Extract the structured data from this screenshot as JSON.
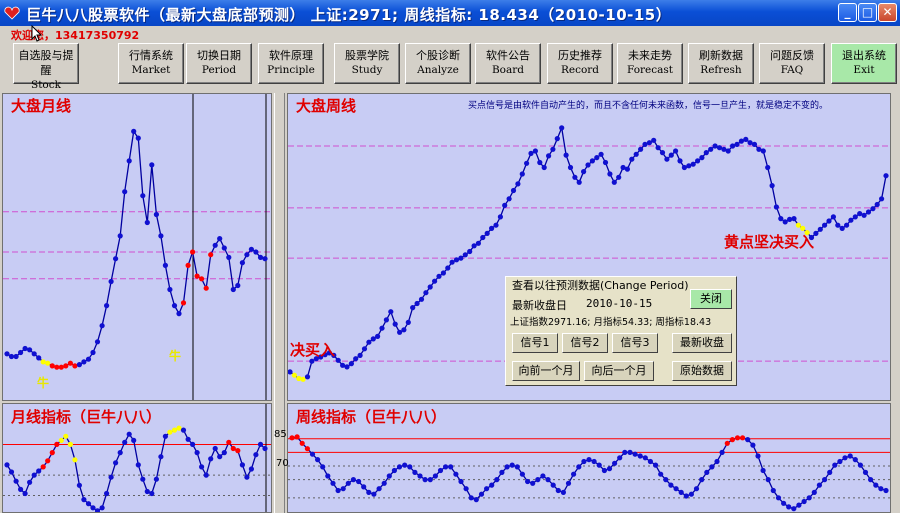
{
  "window": {
    "title": "巨牛八八股票软件（最新大盘底部预测）  上证:2971; 周线指标: 18.434（2010-10-15）",
    "minimize_glyph": "_",
    "maximize_glyph": "□",
    "close_glyph": "✕"
  },
  "welcome_text": "欢迎您，13417350792",
  "toolbar": [
    {
      "cn": "自选股与提醒",
      "en": "Stock Manage"
    },
    {
      "cn": "行情系统",
      "en": "Market"
    },
    {
      "cn": "切换日期",
      "en": "Period"
    },
    {
      "cn": "软件原理",
      "en": "Principle"
    },
    {
      "cn": "股票学院",
      "en": "Study"
    },
    {
      "cn": "个股诊断",
      "en": "Analyze"
    },
    {
      "cn": "软件公告",
      "en": "Board"
    },
    {
      "cn": "历史推荐",
      "en": "Record"
    },
    {
      "cn": "未来走势",
      "en": "Forecast"
    },
    {
      "cn": "刷新数据",
      "en": "Refresh"
    },
    {
      "cn": "问题反馈",
      "en": "FAQ"
    },
    {
      "cn": "退出系统",
      "en": "Exit"
    }
  ],
  "panels": {
    "month_title": "大盘月线",
    "week_title": "大盘周线",
    "month_ind_title": "月线指标（巨牛八八）",
    "week_ind_title": "周线指标（巨牛八八）",
    "week_note": "买点信号是由软件自动产生的，而且不含任何未来函数，信号一旦产生，就是稳定不变的。",
    "anno_buy": "决买入",
    "anno_yellow": "黄点坚决买入",
    "anno_niu": "牛",
    "ind_tick_85": "85",
    "ind_tick_70": "70"
  },
  "dialog": {
    "title": "查看以往预测数据(Change Period)",
    "date_label": "最新收盘日",
    "date_value": "2010-10-15",
    "info": "上证指数2971.16; 月指标54.33; 周指标18.43",
    "close": "关闭",
    "sig1": "信号1",
    "sig2": "信号2",
    "sig3": "信号3",
    "latest": "最新收盘",
    "prev_month": "向前一个月",
    "next_month": "向后一个月",
    "raw_data": "原始数据"
  },
  "colors": {
    "panel_bg": "#c8ccf4",
    "line": "#0000a0",
    "point": "#1010d0",
    "buy": "#ff0000",
    "yellow": "#ffff00",
    "ref_line": "#ff0000",
    "dash_line": "#d050d0"
  },
  "chart_data": [
    {
      "type": "line",
      "name": "大盘月线",
      "title": "大盘月线",
      "values": [
        24,
        22,
        22,
        25,
        28,
        27,
        24,
        21,
        18,
        17,
        15,
        14,
        14,
        15,
        17,
        15,
        16,
        18,
        20,
        25,
        33,
        45,
        60,
        78,
        95,
        112,
        145,
        168,
        190,
        185,
        142,
        122,
        165,
        128,
        112,
        90,
        72,
        60,
        54,
        62,
        90,
        100,
        82,
        80,
        73,
        98,
        105,
        110,
        103,
        96,
        72,
        75,
        92,
        98,
        102,
        100,
        96,
        95
      ],
      "red_points": [
        9,
        10,
        11,
        12,
        13,
        14,
        15,
        39,
        40,
        41,
        42,
        43,
        44,
        45
      ],
      "yellow_points": [
        8,
        9
      ]
    },
    {
      "type": "line",
      "name": "大盘周线",
      "title": "大盘周线",
      "values": [
        22,
        18,
        14,
        13,
        16,
        35,
        38,
        40,
        43,
        45,
        42,
        36,
        30,
        28,
        32,
        38,
        42,
        50,
        58,
        62,
        65,
        75,
        85,
        95,
        80,
        70,
        73,
        82,
        100,
        105,
        110,
        118,
        125,
        132,
        138,
        142,
        148,
        155,
        158,
        160,
        164,
        168,
        175,
        178,
        185,
        190,
        196,
        200,
        210,
        224,
        232,
        242,
        250,
        262,
        275,
        287,
        290,
        276,
        270,
        284,
        292,
        305,
        318,
        285,
        270,
        258,
        252,
        265,
        273,
        278,
        282,
        286,
        276,
        262,
        252,
        258,
        270,
        268,
        280,
        286,
        292,
        298,
        300,
        303,
        294,
        288,
        280,
        285,
        290,
        278,
        270,
        272,
        274,
        278,
        282,
        288,
        292,
        296,
        294,
        292,
        290,
        296,
        298,
        302,
        304,
        300,
        298,
        292,
        290,
        270,
        248,
        222,
        208,
        204,
        207,
        208,
        200,
        196,
        191,
        185,
        190,
        195,
        200,
        205,
        210,
        200,
        196,
        200,
        206,
        210,
        214,
        212,
        216,
        220,
        225,
        232,
        260
      ],
      "yellow_points": [
        1,
        2,
        3,
        116,
        117,
        118
      ]
    },
    {
      "type": "line",
      "name": "月线指标",
      "title": "月线指标（巨牛八八）",
      "values": [
        50,
        43,
        34,
        26,
        22,
        33,
        40,
        44,
        48,
        54,
        62,
        70,
        74,
        78,
        70,
        55,
        30,
        16,
        12,
        8,
        5,
        8,
        22,
        38,
        52,
        62,
        72,
        80,
        74,
        50,
        36,
        24,
        22,
        36,
        58,
        78,
        82,
        84,
        86,
        84,
        75,
        70,
        62,
        48,
        40,
        56,
        66,
        58,
        62,
        72,
        66,
        64,
        50,
        38,
        46,
        60,
        70,
        66
      ],
      "red_points": [
        8,
        9,
        10,
        11,
        49,
        50,
        51
      ],
      "yellow_points": [
        12,
        13,
        14,
        15,
        36,
        37,
        38
      ],
      "reference_lines": [
        70
      ]
    },
    {
      "type": "line",
      "name": "周线指标",
      "title": "周线指标（巨牛八八）",
      "values": [
        86,
        87,
        80,
        74,
        68,
        62,
        54,
        44,
        36,
        28,
        30,
        36,
        40,
        38,
        32,
        26,
        24,
        30,
        36,
        44,
        50,
        54,
        56,
        54,
        48,
        44,
        40,
        40,
        44,
        50,
        54,
        54,
        46,
        38,
        30,
        20,
        18,
        24,
        30,
        34,
        40,
        48,
        54,
        56,
        54,
        46,
        38,
        36,
        40,
        44,
        40,
        34,
        28,
        26,
        36,
        46,
        54,
        60,
        62,
        60,
        56,
        50,
        52,
        58,
        64,
        70,
        70,
        68,
        66,
        64,
        60,
        56,
        46,
        40,
        34,
        30,
        26,
        22,
        24,
        30,
        40,
        48,
        54,
        60,
        70,
        80,
        84,
        86,
        86,
        84,
        78,
        66,
        50,
        40,
        28,
        20,
        14,
        10,
        8,
        12,
        16,
        20,
        26,
        34,
        40,
        48,
        56,
        60,
        64,
        66,
        62,
        56,
        48,
        40,
        34,
        30,
        28
      ],
      "red_points": [
        0,
        1,
        2,
        3,
        85,
        86,
        87,
        88
      ],
      "reference_lines": [
        85,
        70
      ]
    }
  ]
}
